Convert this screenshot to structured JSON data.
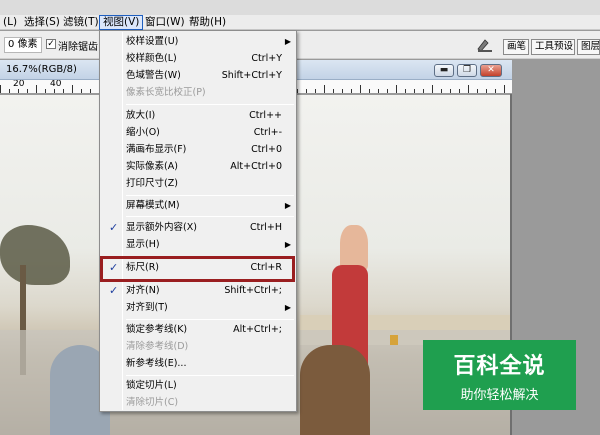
{
  "menubar": {
    "items": [
      "(L)",
      "选择(S)",
      "滤镜(T)",
      "视图(V)",
      "窗口(W)",
      "帮助(H)"
    ],
    "active": "视图(V)"
  },
  "options_bar": {
    "feather_value": "0 像素",
    "antialias_checked": true,
    "antialias_label": "消除锯齿",
    "palette_tabs": [
      "画笔",
      "工具预设",
      "图层"
    ]
  },
  "document": {
    "title": "16.7%(RGB/8)",
    "window_buttons": [
      "minimize",
      "restore",
      "close"
    ],
    "ruler_labels": [
      "20",
      "40"
    ]
  },
  "view_menu": {
    "items": [
      {
        "label": "校样设置(U)",
        "shortcut": "",
        "submenu": true,
        "checked": false,
        "disabled": false
      },
      {
        "label": "校样颜色(L)",
        "shortcut": "Ctrl+Y",
        "submenu": false,
        "checked": false,
        "disabled": false
      },
      {
        "label": "色域警告(W)",
        "shortcut": "Shift+Ctrl+Y",
        "submenu": false,
        "checked": false,
        "disabled": false
      },
      {
        "label": "像素长宽比校正(P)",
        "shortcut": "",
        "submenu": false,
        "checked": false,
        "disabled": true
      },
      {
        "separator": true
      },
      {
        "label": "放大(I)",
        "shortcut": "Ctrl++",
        "submenu": false,
        "checked": false,
        "disabled": false
      },
      {
        "label": "缩小(O)",
        "shortcut": "Ctrl+-",
        "submenu": false,
        "checked": false,
        "disabled": false
      },
      {
        "label": "满画布显示(F)",
        "shortcut": "Ctrl+0",
        "submenu": false,
        "checked": false,
        "disabled": false
      },
      {
        "label": "实际像素(A)",
        "shortcut": "Alt+Ctrl+0",
        "submenu": false,
        "checked": false,
        "disabled": false
      },
      {
        "label": "打印尺寸(Z)",
        "shortcut": "",
        "submenu": false,
        "checked": false,
        "disabled": false
      },
      {
        "separator": true
      },
      {
        "label": "屏幕模式(M)",
        "shortcut": "",
        "submenu": true,
        "checked": false,
        "disabled": false
      },
      {
        "separator": true
      },
      {
        "label": "显示额外内容(X)",
        "shortcut": "Ctrl+H",
        "submenu": false,
        "checked": true,
        "disabled": false
      },
      {
        "label": "显示(H)",
        "shortcut": "",
        "submenu": true,
        "checked": false,
        "disabled": false
      },
      {
        "separator": true
      },
      {
        "label": "标尺(R)",
        "shortcut": "Ctrl+R",
        "submenu": false,
        "checked": true,
        "disabled": false,
        "highlighted": true
      },
      {
        "separator": true
      },
      {
        "label": "对齐(N)",
        "shortcut": "Shift+Ctrl+;",
        "submenu": false,
        "checked": true,
        "disabled": false
      },
      {
        "label": "对齐到(T)",
        "shortcut": "",
        "submenu": true,
        "checked": false,
        "disabled": false
      },
      {
        "separator": true
      },
      {
        "label": "锁定参考线(K)",
        "shortcut": "Alt+Ctrl+;",
        "submenu": false,
        "checked": false,
        "disabled": false
      },
      {
        "label": "清除参考线(D)",
        "shortcut": "",
        "submenu": false,
        "checked": false,
        "disabled": true
      },
      {
        "label": "新参考线(E)...",
        "shortcut": "",
        "submenu": false,
        "checked": false,
        "disabled": false
      },
      {
        "separator": true
      },
      {
        "label": "锁定切片(L)",
        "shortcut": "",
        "submenu": false,
        "checked": false,
        "disabled": false
      },
      {
        "label": "清除切片(C)",
        "shortcut": "",
        "submenu": false,
        "checked": false,
        "disabled": true
      }
    ]
  },
  "watermark": {
    "title": "百科全说",
    "subtitle": "助你轻松解决"
  },
  "colors": {
    "highlight_border": "#9a1e20",
    "watermark_bg": "#1f9f4f",
    "check_color": "#1f3f9f"
  }
}
